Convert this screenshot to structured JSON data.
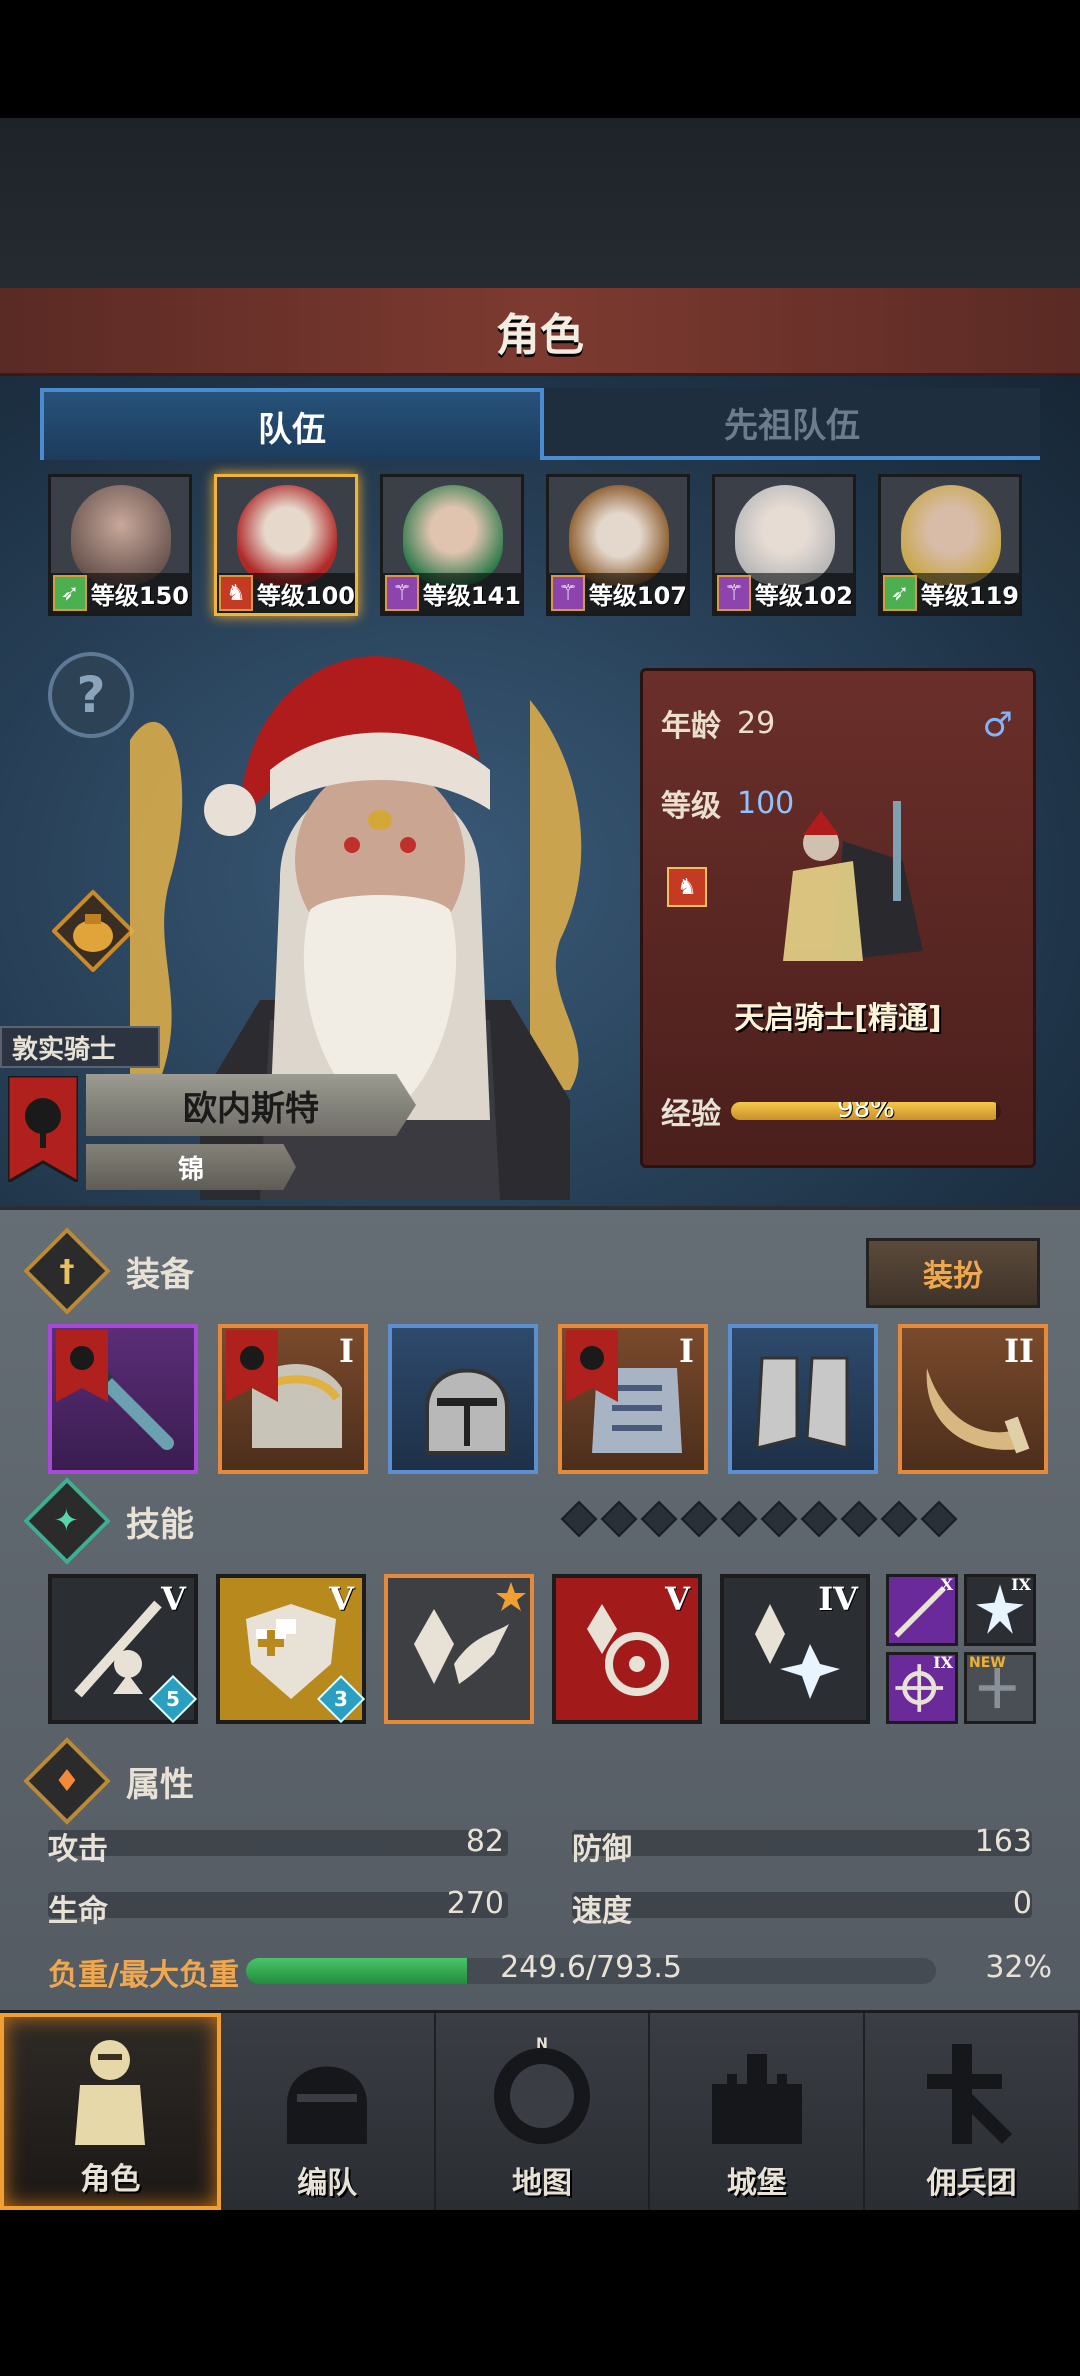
{
  "header": {
    "title": "角色"
  },
  "tabs": [
    {
      "label": "队伍",
      "active": true
    },
    {
      "label": "先祖队伍",
      "active": false
    }
  ],
  "roster": [
    {
      "level_label": "等级150",
      "class_icon": "bow-icon",
      "badge_color": "#4caf50",
      "selected": false
    },
    {
      "level_label": "等级100",
      "class_icon": "horse-icon",
      "badge_color": "#c43a22",
      "selected": true
    },
    {
      "level_label": "等级141",
      "class_icon": "staff-icon",
      "badge_color": "#8e44ad",
      "selected": false
    },
    {
      "level_label": "等级107",
      "class_icon": "staff-icon",
      "badge_color": "#8e44ad",
      "selected": false
    },
    {
      "level_label": "等级102",
      "class_icon": "staff-icon",
      "badge_color": "#8e44ad",
      "selected": false
    },
    {
      "level_label": "等级119",
      "class_icon": "bow-icon",
      "badge_color": "#4caf50",
      "selected": false
    }
  ],
  "character": {
    "title": "敦实骑士",
    "name": "欧内斯特",
    "rank": "锦"
  },
  "info": {
    "age_label": "年龄",
    "age": "29",
    "gender_symbol": "♂",
    "level_label": "等级",
    "level": "100",
    "class_name": "天启骑士[精通]",
    "exp_label": "经验",
    "exp_pct": "98%",
    "exp_fraction": 0.98
  },
  "equipment": {
    "label": "装备",
    "dress_button": "装扮",
    "slots": [
      {
        "item": "staff-icon",
        "rarity": "purple",
        "tier": "",
        "flag": true
      },
      {
        "item": "armor-icon",
        "rarity": "orange",
        "tier": "I",
        "flag": true
      },
      {
        "item": "helmet-icon",
        "rarity": "blue",
        "tier": "",
        "flag": false
      },
      {
        "item": "chest-armor-icon",
        "rarity": "orange",
        "tier": "I",
        "flag": true
      },
      {
        "item": "boots-icon",
        "rarity": "blue",
        "tier": "",
        "flag": false
      },
      {
        "item": "horn-icon",
        "rarity": "orange",
        "tier": "II",
        "flag": false
      }
    ]
  },
  "skills": {
    "label": "技能",
    "slot_dots": 10,
    "main": [
      {
        "icon": "lance-knight-icon",
        "tier": "V",
        "badge": "5",
        "bg": "#2b2f33"
      },
      {
        "icon": "holy-shield-icon",
        "tier": "V",
        "badge": "3",
        "bg": "#b88a1e"
      },
      {
        "icon": "crystal-slash-icon",
        "tier": "",
        "badge": "",
        "bg": "#3d3f42",
        "star": true
      },
      {
        "icon": "target-crystal-icon",
        "tier": "V",
        "badge": "",
        "bg": "#a21a1a"
      },
      {
        "icon": "crystal-burst-icon",
        "tier": "IV",
        "badge": "",
        "bg": "#2b2f33"
      }
    ],
    "mini": [
      {
        "icon": "spear-icon",
        "tier": "X",
        "bg": "#6a2a9a",
        "new": false
      },
      {
        "icon": "burst-icon",
        "tier": "IX",
        "bg": "#2b2f33",
        "new": false
      },
      {
        "icon": "sigil-icon",
        "tier": "IX",
        "bg": "#6a2a9a",
        "new": false
      },
      {
        "icon": "cross-icon",
        "tier": "",
        "bg": "#4a4f55",
        "new": true,
        "new_label": "NEW"
      }
    ]
  },
  "attributes": {
    "label": "属性",
    "attack_label": "攻击",
    "attack": "82",
    "defense_label": "防御",
    "defense": "163",
    "hp_label": "生命",
    "hp": "270",
    "speed_label": "速度",
    "speed": "0",
    "load_label": "负重/最大负重",
    "load_value": "249.6/793.5",
    "load_pct": "32%",
    "load_fraction": 0.32
  },
  "nav": [
    {
      "label": "角色",
      "icon": "knight-icon",
      "active": true
    },
    {
      "label": "编队",
      "icon": "helmet-icon",
      "active": false
    },
    {
      "label": "地图",
      "icon": "compass-icon",
      "active": false
    },
    {
      "label": "城堡",
      "icon": "castle-icon",
      "active": false
    },
    {
      "label": "佣兵团",
      "icon": "mercenary-icon",
      "active": false
    }
  ],
  "colors": {
    "accent": "#f0a030",
    "tab_blue": "#4b8bd0",
    "panel_red": "#6b2f2a",
    "rarity_purple": "#a84ad8",
    "rarity_orange": "#e48a3a",
    "rarity_blue": "#5b8fd0",
    "load_green": "#3aa852"
  }
}
